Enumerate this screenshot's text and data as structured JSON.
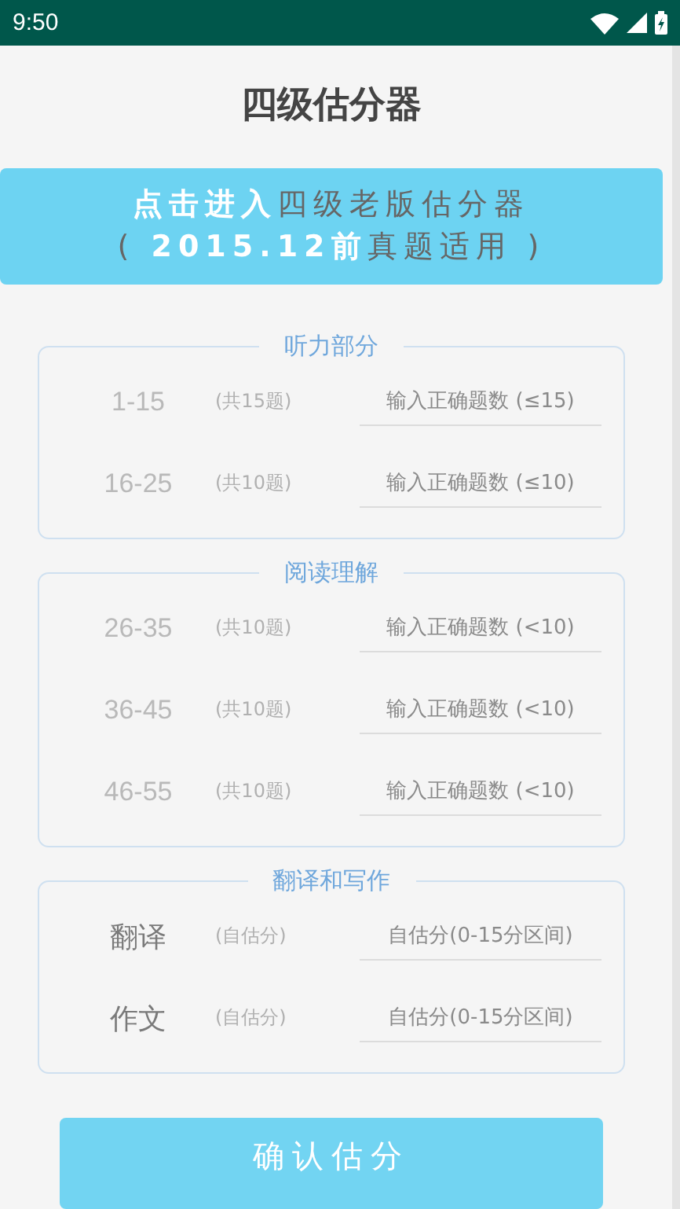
{
  "status_bar": {
    "time": "9:50"
  },
  "title": "四级估分器",
  "banner": {
    "line_1": "**点击进入**四级老版估分器",
    "line_2": "( **2015.12前**真题适用 )"
  },
  "sections": [
    {
      "title": "听力部分",
      "rows": [
        {
          "kind": "range",
          "label": "1-15",
          "note": "(共15题)",
          "placeholder": "输入正确题数 (≤15)"
        },
        {
          "kind": "range",
          "label": "16-25",
          "note": "(共10题)",
          "placeholder": "输入正确题数 (≤10)"
        }
      ]
    },
    {
      "title": "阅读理解",
      "rows": [
        {
          "kind": "range",
          "label": "26-35",
          "note": "(共10题)",
          "placeholder": "输入正确题数 (<10)"
        },
        {
          "kind": "range",
          "label": "36-45",
          "note": "(共10题)",
          "placeholder": "输入正确题数 (<10)"
        },
        {
          "kind": "range",
          "label": "46-55",
          "note": "(共10题)",
          "placeholder": "输入正确题数 (<10)"
        }
      ]
    },
    {
      "title": "翻译和写作",
      "rows": [
        {
          "kind": "essay",
          "label": "翻译",
          "note": "(自估分)",
          "placeholder": "自估分(0-15分区间)"
        },
        {
          "kind": "essay",
          "label": "作文",
          "note": "(自估分)",
          "placeholder": "自估分(0-15分区间)"
        }
      ]
    }
  ],
  "submit_button": "确认估分"
}
